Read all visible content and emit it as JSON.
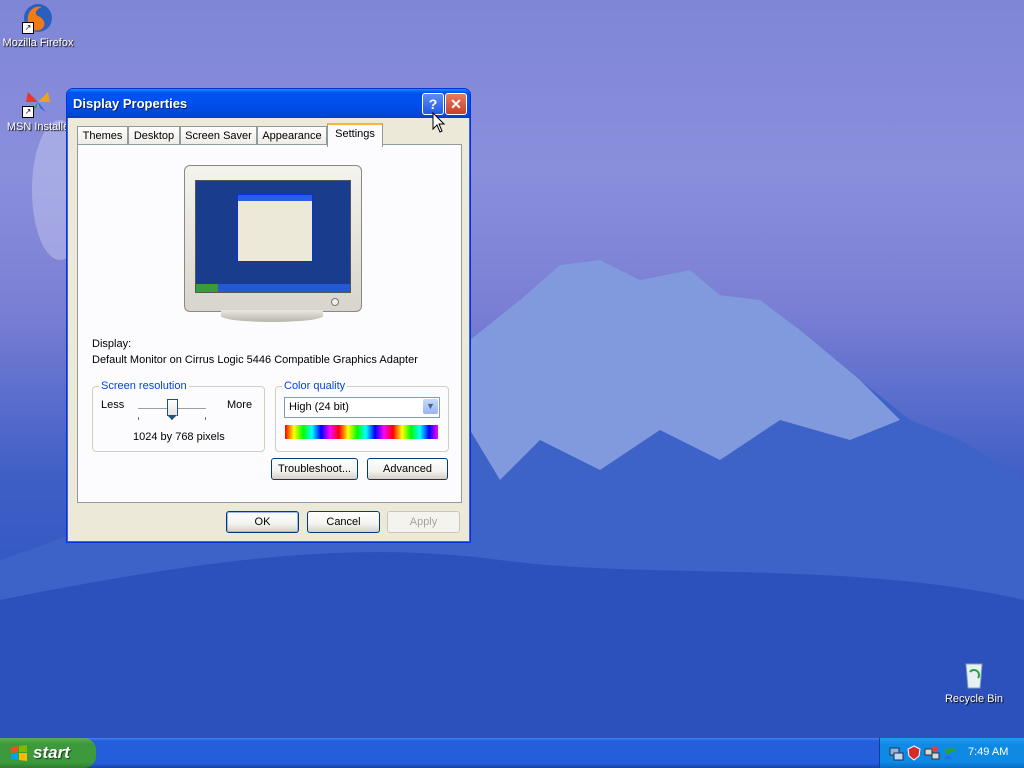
{
  "desktop": {
    "icons": [
      {
        "label": "Mozilla Firefox"
      },
      {
        "label": "MSN Installe"
      },
      {
        "label": "Recycle Bin"
      }
    ]
  },
  "window": {
    "title": "Display Properties",
    "help_glyph": "?",
    "close_glyph": "✕",
    "tabs": [
      {
        "label": "Themes"
      },
      {
        "label": "Desktop"
      },
      {
        "label": "Screen Saver"
      },
      {
        "label": "Appearance"
      },
      {
        "label": "Settings",
        "active": true
      }
    ],
    "display_label": "Display:",
    "display_value": "Default Monitor on Cirrus Logic 5446 Compatible Graphics Adapter",
    "resolution": {
      "title": "Screen resolution",
      "less_label": "Less",
      "more_label": "More",
      "value_text": "1024 by 768 pixels",
      "slider_position": 0.55
    },
    "color_quality": {
      "title": "Color quality",
      "selected": "High (24 bit)"
    },
    "buttons": {
      "troubleshoot": "Troubleshoot...",
      "advanced": "Advanced",
      "ok": "OK",
      "cancel": "Cancel",
      "apply": "Apply"
    }
  },
  "taskbar": {
    "start_label": "start",
    "clock": "7:49 AM"
  },
  "colors": {
    "title_bar": "#0053ee",
    "accent_tab": "#f7b53c",
    "taskbar": "#245edb",
    "start_button": "#3c9a3c"
  }
}
